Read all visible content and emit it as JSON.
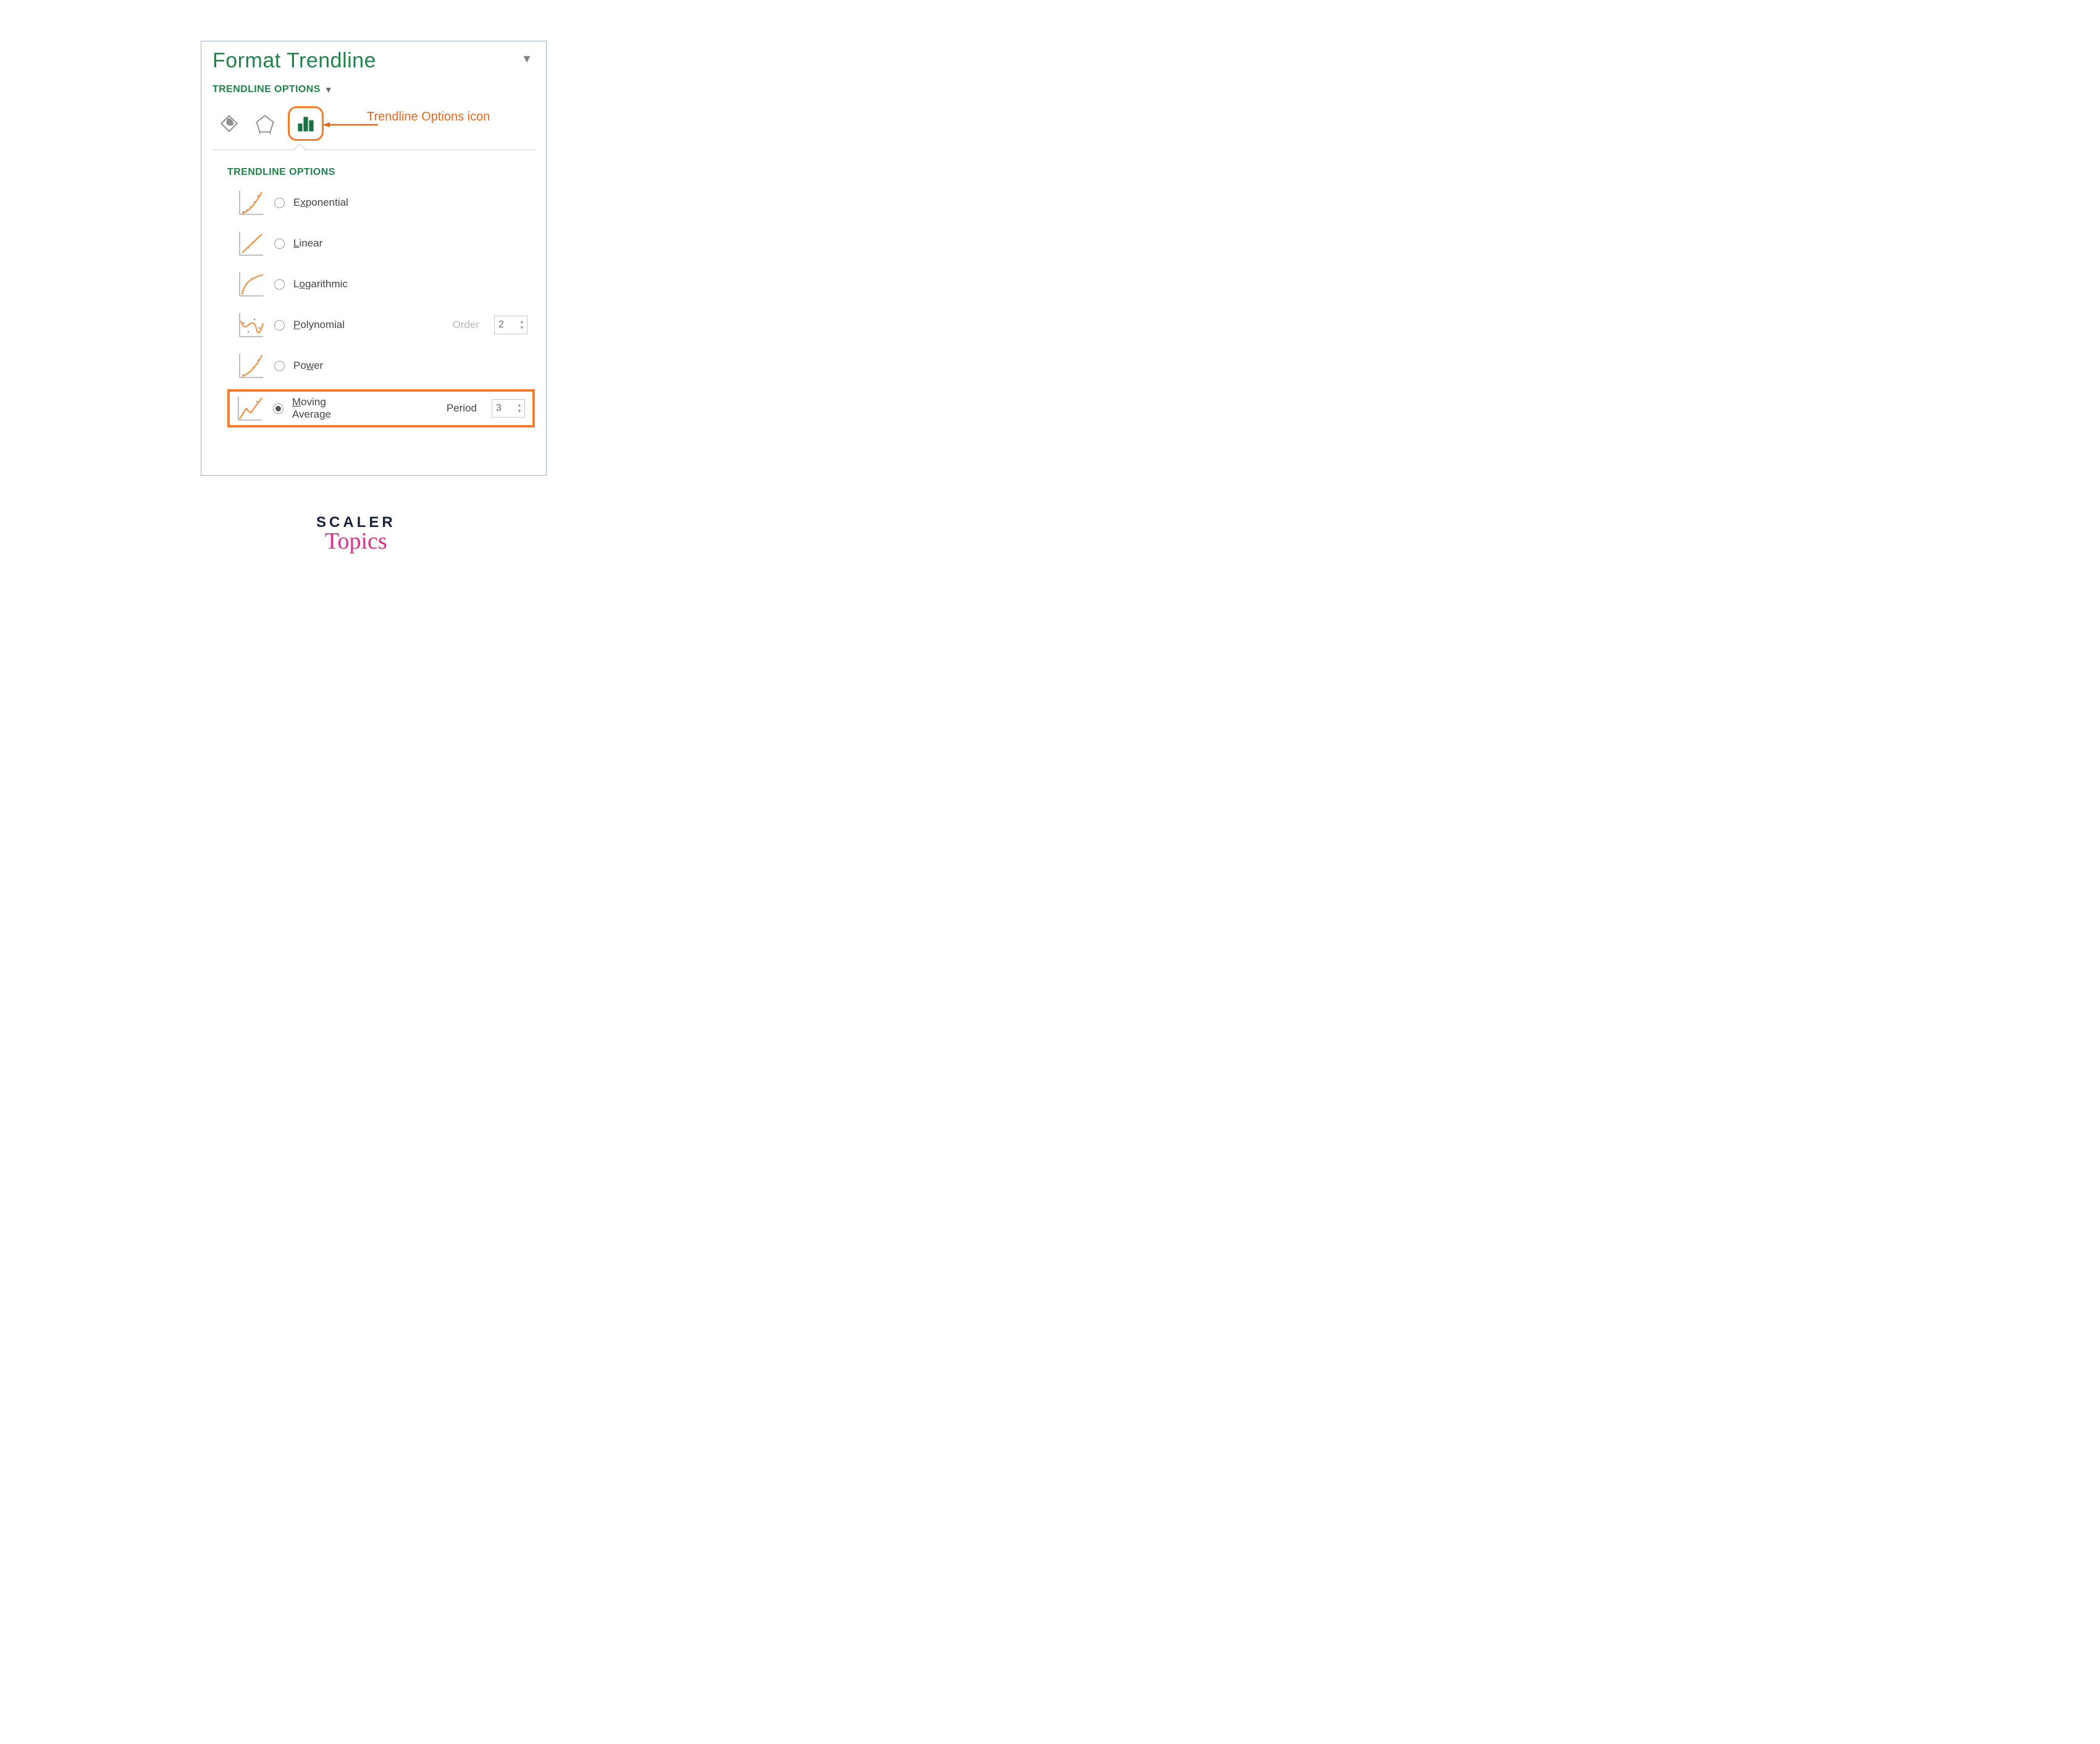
{
  "pane": {
    "title": "Format Trendline",
    "section_label": "TRENDLINE OPTIONS",
    "annotation": "Trendline Options icon",
    "tabs": {
      "fill_line_icon": "fill-line-icon",
      "effects_icon": "effects-icon",
      "options_icon": "bar-chart-icon"
    },
    "group_heading": "TRENDLINE OPTIONS",
    "options": {
      "exponential_html": "E<span class='mn'>x</span>ponential",
      "linear_html": "<span class='mn'>L</span>inear",
      "logarithmic_html": "L<span class='mn'>o</span>garithmic",
      "polynomial_html": "<span class='mn'>P</span>olynomial",
      "power_html": "Po<span class='mn'>w</span>er",
      "moving_avg_html": "<span class='mn'>M</span>oving<br>Average",
      "order_label_html": "Ord<span class='mn'>e</span>r",
      "order_value": "2",
      "period_label_html": "P<span class='mn'>e</span>riod",
      "period_value": "3"
    }
  },
  "footer": {
    "line1": "SCALER",
    "line2": "Topics"
  }
}
